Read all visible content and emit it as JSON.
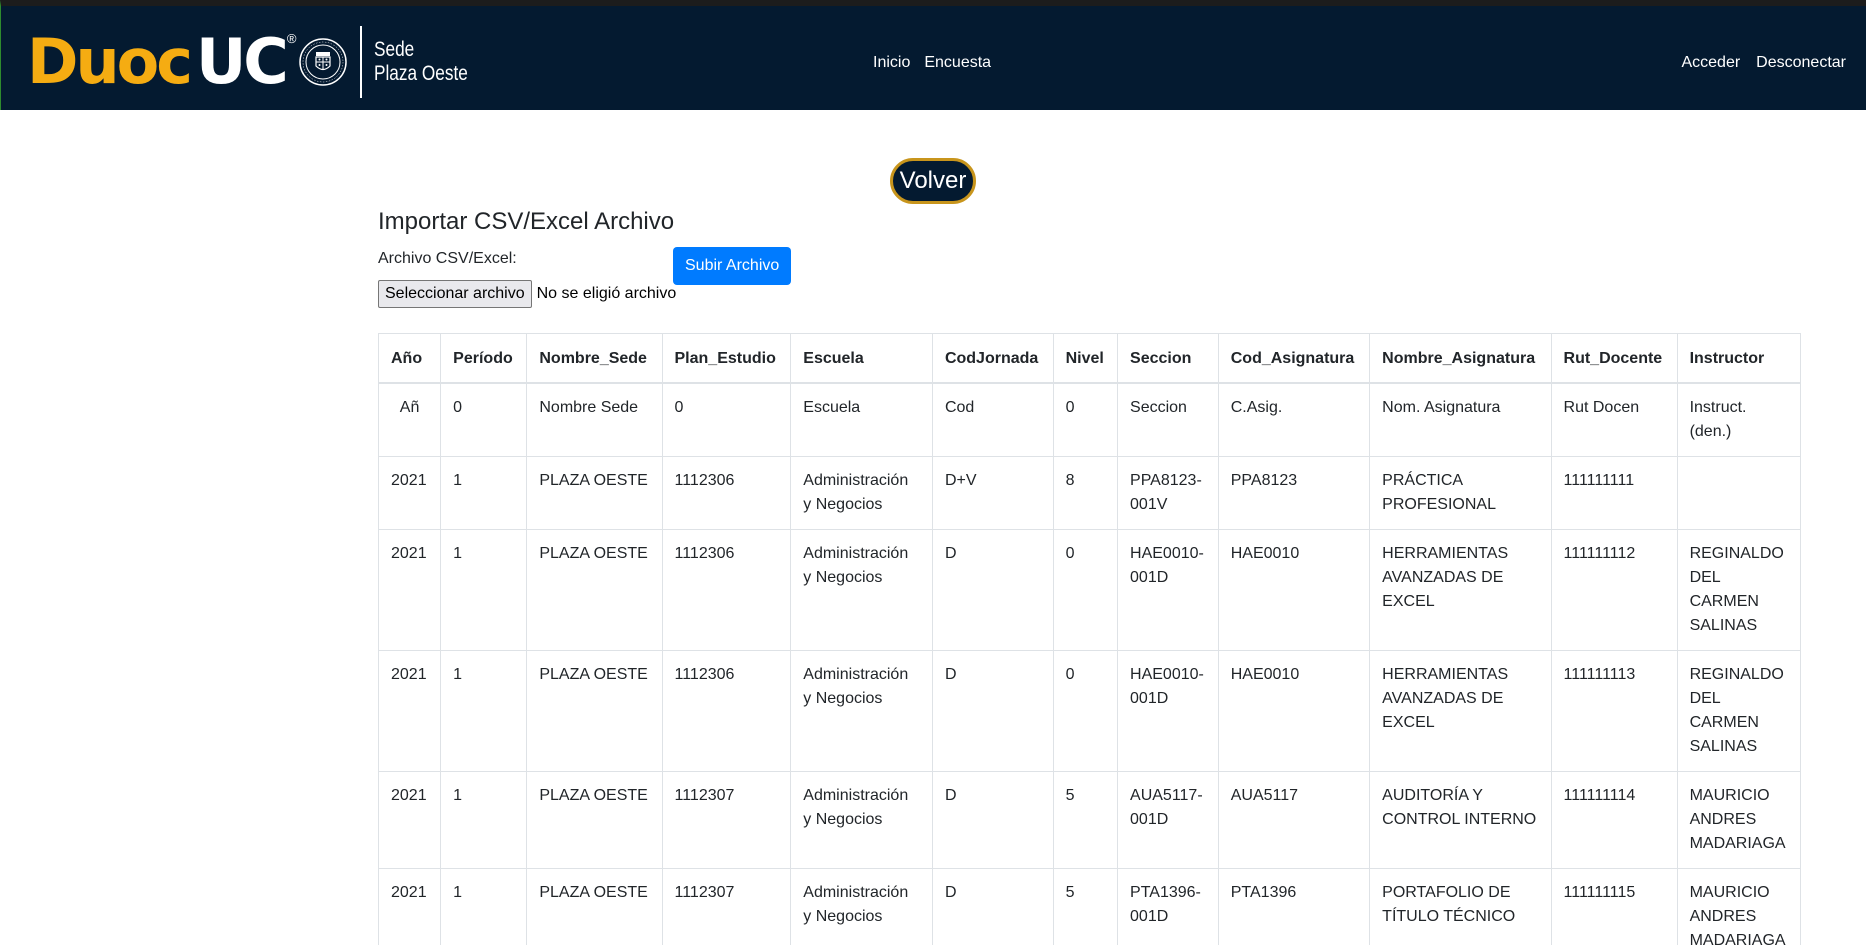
{
  "navbar": {
    "logo_duoc": "Duoc",
    "logo_uc": "UC",
    "logo_reg": "®",
    "sede_line1": "Sede",
    "sede_line2": "Plaza Oeste",
    "center_links": [
      "Inicio",
      "Encuesta"
    ],
    "right_links": [
      "Acceder",
      "Desconectar"
    ]
  },
  "main": {
    "back_button": "Volver",
    "title": "Importar CSV/Excel Archivo",
    "file_label": "Archivo CSV/Excel:",
    "file_button": "Seleccionar archivo",
    "file_status": "No se eligió archivo",
    "upload_button": "Subir Archivo"
  },
  "table": {
    "headers": [
      "Año",
      "Período",
      "Nombre_Sede",
      "Plan_Estudio",
      "Escuela",
      "CodJornada",
      "Nivel",
      "Seccion",
      "Cod_Asignatura",
      "Nombre_Asignatura",
      "Rut_Docente",
      "Instructor"
    ],
    "rows": [
      [
        "Añ",
        "0",
        "Nombre Sede",
        "0",
        "Escuela",
        "Cod",
        "0",
        "Seccion",
        "C.Asig.",
        "Nom. Asignatura",
        "Rut Docen",
        "Instruct. (den.)"
      ],
      [
        "2021",
        "1",
        "PLAZA OESTE",
        "1112306",
        "Administración y Negocios",
        "D+V",
        "8",
        "PPA8123-001V",
        "PPA8123",
        "PRÁCTICA PROFESIONAL",
        "111111111",
        ""
      ],
      [
        "2021",
        "1",
        "PLAZA OESTE",
        "1112306",
        "Administración y Negocios",
        "D",
        "0",
        "HAE0010-001D",
        "HAE0010",
        "HERRAMIENTAS AVANZADAS DE EXCEL",
        "111111112",
        "REGINALDO DEL CARMEN SALINAS"
      ],
      [
        "2021",
        "1",
        "PLAZA OESTE",
        "1112306",
        "Administración y Negocios",
        "D",
        "0",
        "HAE0010-001D",
        "HAE0010",
        "HERRAMIENTAS AVANZADAS DE EXCEL",
        "111111113",
        "REGINALDO DEL CARMEN SALINAS"
      ],
      [
        "2021",
        "1",
        "PLAZA OESTE",
        "1112307",
        "Administración y Negocios",
        "D",
        "5",
        "AUA5117-001D",
        "AUA5117",
        "AUDITORÍA Y CONTROL INTERNO",
        "111111114",
        "MAURICIO ANDRES MADARIAGA"
      ],
      [
        "2021",
        "1",
        "PLAZA OESTE",
        "1112307",
        "Administración y Negocios",
        "D",
        "5",
        "PTA1396-001D",
        "PTA1396",
        "PORTAFOLIO DE TÍTULO TÉCNICO",
        "111111115",
        "MAURICIO ANDRES MADARIAGA"
      ]
    ]
  },
  "colors": {
    "navbar_bg": "#041a30",
    "brand_orange": "#f5ac12",
    "primary_button": "#007bff",
    "volver_border": "#c8951c"
  },
  "icons": {
    "seal": "university-seal-icon"
  }
}
